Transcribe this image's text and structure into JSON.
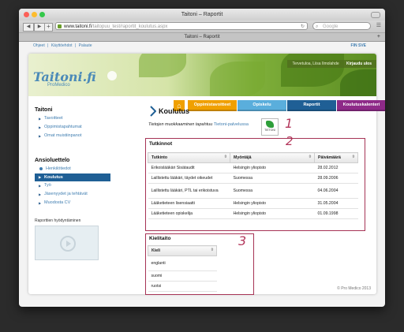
{
  "browser": {
    "window_title": "Taitoni – Raportit",
    "url_host": "www.taitoni.fi",
    "url_path": "/taitopuu_test/raportit_koulutus.aspx",
    "search_placeholder": "Google",
    "tab_title": "Taitoni – Raportit"
  },
  "toplinks": [
    "Ohjeet",
    "|",
    "Käyttöehdot",
    "|",
    "Palaute"
  ],
  "langlinks": "FIN  SVE",
  "header": {
    "logo_text": "Taitoni.fi",
    "logo_sub": "ProMedico",
    "user_text": "Tervetuloa, Liisa Ilmolahde",
    "logout": "Kirjaudu ulos"
  },
  "nav": {
    "home_icon": "house-icon",
    "tabs": [
      {
        "label": "Oppimistavoitteet",
        "color": "#f0a000"
      },
      {
        "label": "Opiskelu",
        "color": "#5aaedc"
      },
      {
        "label": "Raportit",
        "color": "#1f5f95"
      },
      {
        "label": "Koulutuskalenteri",
        "color": "#8e2a88"
      }
    ]
  },
  "sidebar": {
    "section1_title": "Taitoni",
    "section1_items": [
      "Tavoitteet",
      "Oppimistapahtumat",
      "Omat muistiinpanot"
    ],
    "section2_title": "Ansioluettelo",
    "section2_items": [
      {
        "label": "Henkilötiedot",
        "active": false
      },
      {
        "label": "Koulutus",
        "active": true
      },
      {
        "label": "Työ",
        "active": false
      },
      {
        "label": "Jäsenyydet ja tehtävät",
        "active": false
      },
      {
        "label": "Muodosta CV",
        "active": false
      }
    ],
    "video_label": "Raporttien hyödyntäminen"
  },
  "main": {
    "title": "Koulutus",
    "info_text": "Tietojen muokkaaminen tapahtuu ",
    "info_link": "Tietoni-palvelussa",
    "taitoni_button": "TIETONI",
    "annotations": [
      "1",
      "2",
      "3"
    ],
    "tutkinnot_title": "Tutkinnot",
    "tutkinnot_headers": [
      "Tutkinto",
      "Myöntäjä",
      "Päivämäärä"
    ],
    "tutkinnot_rows": [
      [
        "Erikoislääkäri Sisätaudit",
        "Helsingin yliopisto",
        "28.02.2012"
      ],
      [
        "Laillistettu lääkäri, täydet oikeudet",
        "Suomessa",
        "28.09.2006"
      ],
      [
        "Laillistettu lääkäri, PTL tai erikoistuva",
        "Suomessa",
        "04.06.2004"
      ],
      [
        "Lääketieteen lisensiaatti",
        "Helsingin yliopisto",
        "31.05.2004"
      ],
      [
        "Lääketieteen opiskelija",
        "Helsingin yliopisto",
        "01.09.1998"
      ]
    ],
    "kielitaito_title": "Kielitaito",
    "kielitaito_header": "Kieli",
    "kielitaito_rows": [
      "englanti",
      "suomi",
      "ruotsi"
    ]
  },
  "footer": "© Pro Medico 2013",
  "colors": {
    "annotation": "#a63355",
    "link": "#3f7db0",
    "active_nav": "#1f5f95"
  }
}
